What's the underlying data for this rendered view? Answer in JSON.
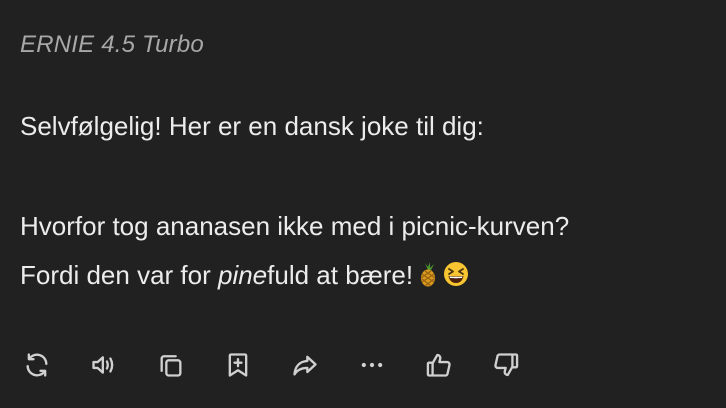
{
  "model": {
    "name": "ERNIE 4.5 Turbo"
  },
  "message": {
    "line1": "Selvfølgelig! Her er en dansk joke til dig:",
    "line2": "Hvorfor tog ananasen ikke med i picnic-kurven?",
    "line3_before": "Fordi den var for ",
    "line3_italic": "pine",
    "line3_after": "fuld at bære!",
    "emojis": [
      "pineapple",
      "grinning-squinting-face"
    ]
  },
  "actions": [
    {
      "icon": "refresh-icon"
    },
    {
      "icon": "speaker-icon"
    },
    {
      "icon": "copy-icon"
    },
    {
      "icon": "bookmark-add-icon"
    },
    {
      "icon": "share-icon"
    },
    {
      "icon": "more-icon"
    },
    {
      "icon": "thumbs-up-icon"
    },
    {
      "icon": "thumbs-down-icon"
    }
  ]
}
